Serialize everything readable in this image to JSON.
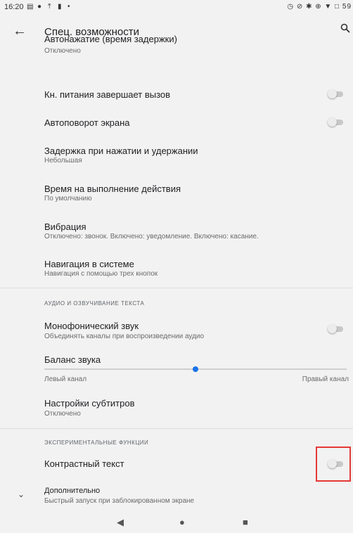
{
  "status": {
    "time": "16:20",
    "left_icons": [
      "gallery-icon",
      "photo-icon",
      "upload-icon",
      "trash-icon",
      "dot-icon"
    ],
    "right_text": "◷ ⊘ ✱ ⊕ ▼ □ 59"
  },
  "appbar": {
    "title": "Спец. возможности",
    "back_icon": "arrow-back-icon",
    "search_icon": "search-icon"
  },
  "items": [
    {
      "title": "Автонажатие (время задержки)",
      "subtitle": "Отключено"
    },
    {
      "title": "Кн. питания завершает вызов",
      "toggle": "off"
    },
    {
      "title": "Автоповорот экрана",
      "toggle": "off"
    },
    {
      "title": "Задержка при нажатии и удержании",
      "subtitle": "Небольшая"
    },
    {
      "title": "Время на выполнение действия",
      "subtitle": "По умолчанию"
    },
    {
      "title": "Вибрация",
      "subtitle": "Отключено: звонок. Включено: уведомление. Включено: касание."
    },
    {
      "title": "Навигация в системе",
      "subtitle": "Навигация с помощью трех кнопок"
    }
  ],
  "section_audio": "аудио и озвучивание текста",
  "audio": [
    {
      "title": "Монофонический звук",
      "subtitle": "Объединять каналы при воспроизведении аудио",
      "toggle": "off"
    },
    {
      "title": "Баланс звука",
      "left_label": "Левый канал",
      "right_label": "Правый канал",
      "balance_value": 0.5
    },
    {
      "title": "Настройки субтитров",
      "subtitle": "Отключено"
    }
  ],
  "section_experimental": "экспериментальные функции",
  "experimental": [
    {
      "title": "Контрастный текст",
      "toggle": "off"
    }
  ],
  "advanced": {
    "title": "Дополнительно",
    "subtitle": "Быстрый запуск при заблокированном экране",
    "icon": "chevron-down-icon"
  },
  "navbar": {
    "back": "◀",
    "home": "●",
    "recents": "■"
  }
}
